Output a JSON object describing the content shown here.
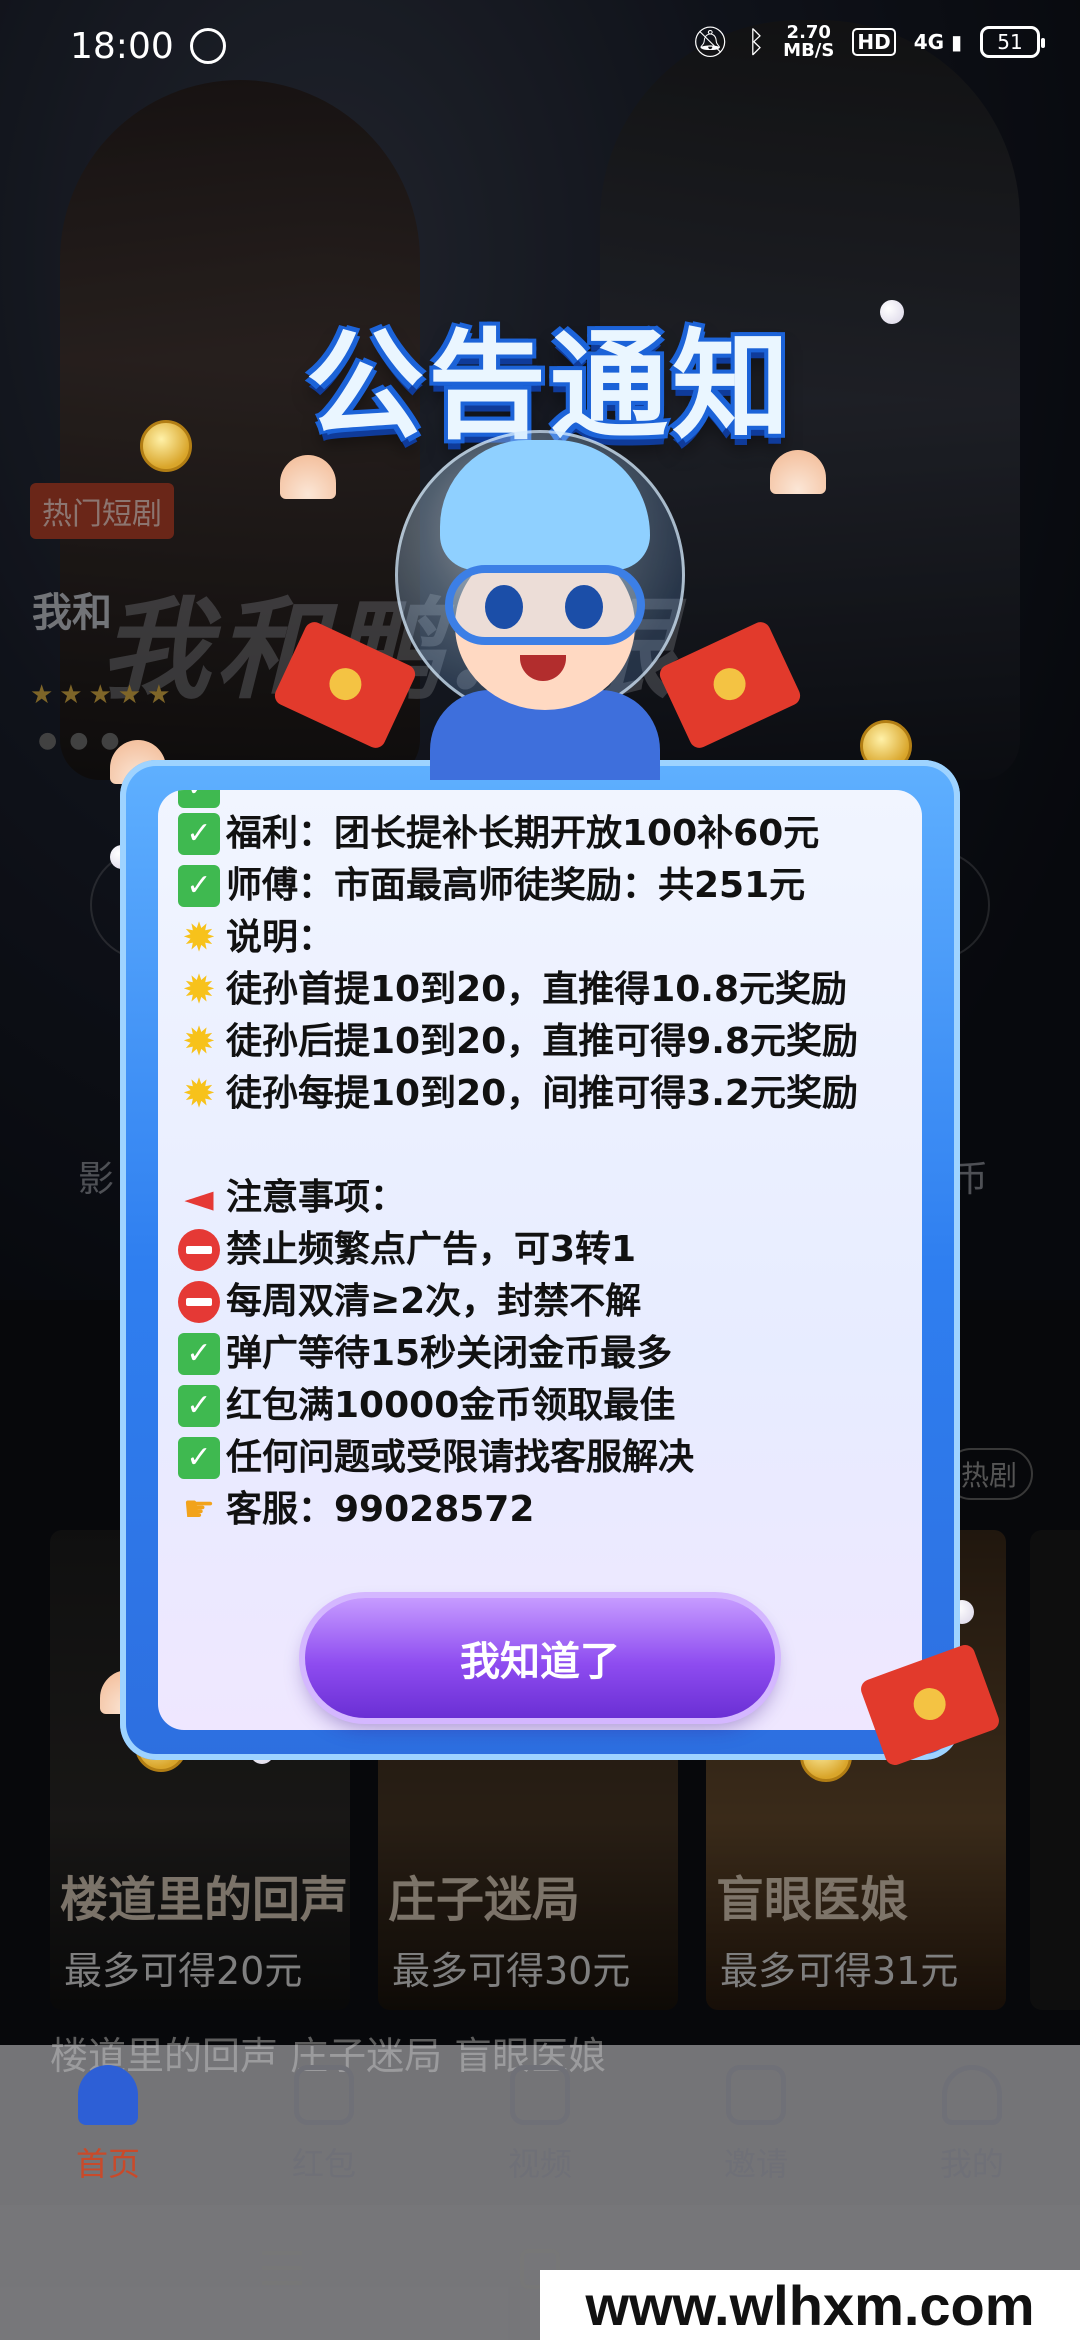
{
  "status_bar": {
    "time": "18:00",
    "net_speed_value": "2.70",
    "net_speed_unit": "MB/S",
    "hd": "HD",
    "network": "4G",
    "battery": "51"
  },
  "background": {
    "hot_tag": "热门短剧",
    "hero_title_small": "我和",
    "hero_title_big": "我和鸭…眼，",
    "side_label_left": "影",
    "side_label_right": "币",
    "hot_right": "热剧",
    "posters": [
      {
        "title": "楼道里的回声",
        "reward": "最多可得20元"
      },
      {
        "title": "庄子迷局",
        "reward": "最多可得30元"
      },
      {
        "title": "盲眼医娘",
        "reward": "最多可得31元"
      }
    ],
    "poster_captions": "楼道里的回声    庄子迷局    盲眼医娘"
  },
  "modal": {
    "headline": "公告通知",
    "lines": [
      {
        "icon": "check",
        "text": "福利：团长提补长期开放100补60元"
      },
      {
        "icon": "check",
        "text": "师傅：市面最高师徒奖励：共251元"
      },
      {
        "icon": "star",
        "text": "说明："
      },
      {
        "icon": "star",
        "text": "徒孙首提10到20，直推得10.8元奖励"
      },
      {
        "icon": "star",
        "text": "徒孙后提10到20，直推可得9.8元奖励"
      },
      {
        "icon": "star",
        "text": "徒孙每提10到20，间推可得3.2元奖励"
      },
      {
        "icon": "",
        "text": ""
      },
      {
        "icon": "megaphone",
        "text": "注意事项："
      },
      {
        "icon": "stop",
        "text": "禁止频繁点广告，可3转1"
      },
      {
        "icon": "stop",
        "text": "每周双清≥2次，封禁不解"
      },
      {
        "icon": "check",
        "text": "弹广等待15秒关闭金币最多"
      },
      {
        "icon": "check",
        "text": "红包满10000金币领取最佳"
      },
      {
        "icon": "check",
        "text": "任何问题或受限请找客服解决"
      },
      {
        "icon": "hand",
        "text": "客服：99028572"
      }
    ],
    "confirm_button": "我知道了"
  },
  "tabbar": {
    "tabs": [
      {
        "label": "首页",
        "icon": "home-icon",
        "active": true
      },
      {
        "label": "红包",
        "icon": "red-packet-icon",
        "active": false
      },
      {
        "label": "视频",
        "icon": "video-icon",
        "active": false
      },
      {
        "label": "邀请",
        "icon": "invite-icon",
        "active": false
      },
      {
        "label": "我的",
        "icon": "user-icon",
        "active": false
      }
    ]
  },
  "watermark": "www.wlhxm.com",
  "colors": {
    "accent_active": "#c94a2a",
    "panel_blue": "#2f7ff0",
    "button_purple": "#8e4cf0"
  }
}
